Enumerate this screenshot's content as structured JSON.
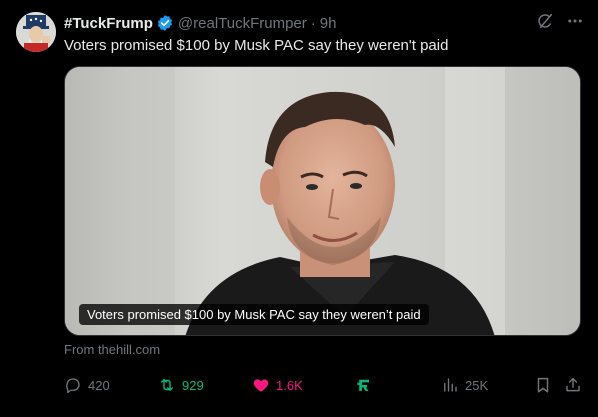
{
  "post": {
    "display_name": "#TuckFrump",
    "handle": "@realTuckFrumper",
    "separator": "·",
    "time": "9h",
    "text": "Voters promised $100 by Musk PAC say they weren't paid"
  },
  "media": {
    "caption": "Voters promised $100 by Musk PAC say they weren’t paid",
    "source": "From thehill.com"
  },
  "actions": {
    "replies": "420",
    "reposts": "929",
    "likes": "1.6K",
    "views": "25K"
  },
  "colors": {
    "background": "#000000",
    "text": "#e7e9ea",
    "muted": "#71767b",
    "verified": "#1d9bf0",
    "repost_active": "#00ba7c",
    "like_active": "#f91880",
    "grok_icon": "#00ba7c"
  },
  "icons": {
    "verified": "verified-badge-icon",
    "grok": "grok-icon",
    "more": "more-icon",
    "reply": "reply-icon",
    "repost": "repost-icon",
    "like": "heart-icon",
    "extension": "extension-icon",
    "views": "views-icon",
    "bookmark": "bookmark-icon",
    "share": "share-icon"
  }
}
